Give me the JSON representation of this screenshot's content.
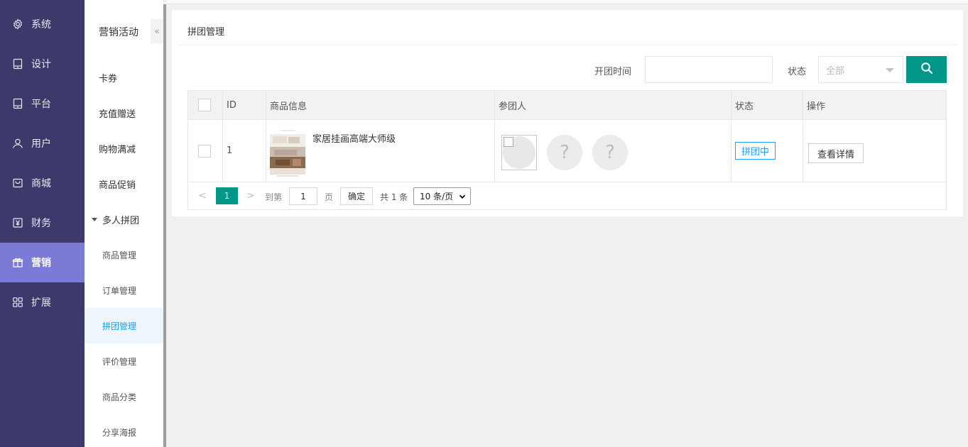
{
  "sidebar": {
    "items": [
      {
        "label": "系统",
        "icon": "gear-icon"
      },
      {
        "label": "设计",
        "icon": "tablet-icon"
      },
      {
        "label": "平台",
        "icon": "tablet-icon"
      },
      {
        "label": "用户",
        "icon": "user-icon"
      },
      {
        "label": "商城",
        "icon": "store-icon"
      },
      {
        "label": "财务",
        "icon": "yen-icon"
      },
      {
        "label": "营销",
        "icon": "gift-icon",
        "active": true
      },
      {
        "label": "扩展",
        "icon": "grid-icon"
      }
    ]
  },
  "submenu": {
    "title": "营销活动",
    "collapse_icon": "«",
    "items": [
      "卡券",
      "充值赠送",
      "购物满减",
      "商品促销"
    ],
    "group": {
      "label": "多人拼团",
      "items": [
        "商品管理",
        "订单管理",
        "拼团管理",
        "评价管理",
        "商品分类",
        "分享海报"
      ],
      "active": "拼团管理"
    }
  },
  "page": {
    "title": "拼团管理",
    "filters": {
      "time_label": "开团时间",
      "time_value": "",
      "status_label": "状态",
      "status_value": "全部"
    }
  },
  "table": {
    "headers": [
      "ID",
      "商品信息",
      "参团人",
      "状态",
      "操作"
    ],
    "rows": [
      {
        "id": "1",
        "product": "家居挂画高端大师级",
        "placeholder_avatar": "?",
        "status": "拼团中",
        "action": "查看详情"
      }
    ]
  },
  "pager": {
    "prev": "<",
    "current": "1",
    "next": ">",
    "goto_label": "到第",
    "goto_value": "1",
    "page_unit": "页",
    "confirm": "确定",
    "total": "共 1 条",
    "page_size": "10 条/页"
  },
  "colors": {
    "sidebar_bg": "#3b3a6b",
    "sidebar_active": "#7c7ad7",
    "primary": "#009688",
    "link_blue": "#1e9fff"
  }
}
